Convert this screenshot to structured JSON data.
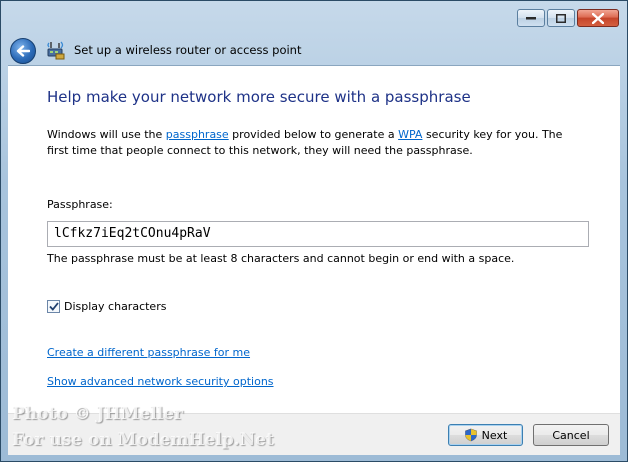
{
  "window": {
    "title": "Set up a wireless router or access point"
  },
  "main": {
    "heading": "Help make your network more secure with a passphrase",
    "description": {
      "part1": "Windows will use the ",
      "link1": "passphrase",
      "part2": " provided below to generate a ",
      "link2": "WPA",
      "part3": " security key for you. The first time that people connect to this network, they will need the passphrase."
    },
    "passphrase_label": "Passphrase:",
    "passphrase_value": "lCfkz7iEq2tCOnu4pRaV",
    "passphrase_hint": "The passphrase must be at least 8 characters and cannot begin or end with a space.",
    "display_characters_label": "Display characters",
    "display_characters_checked": true,
    "link_create": "Create a different passphrase for me",
    "link_advanced": "Show advanced network security options"
  },
  "footer": {
    "next_label": "Next",
    "cancel_label": "Cancel"
  },
  "watermark": {
    "line1": "Photo © JHMeller",
    "line2": "For use on ModemHelp.Net"
  }
}
